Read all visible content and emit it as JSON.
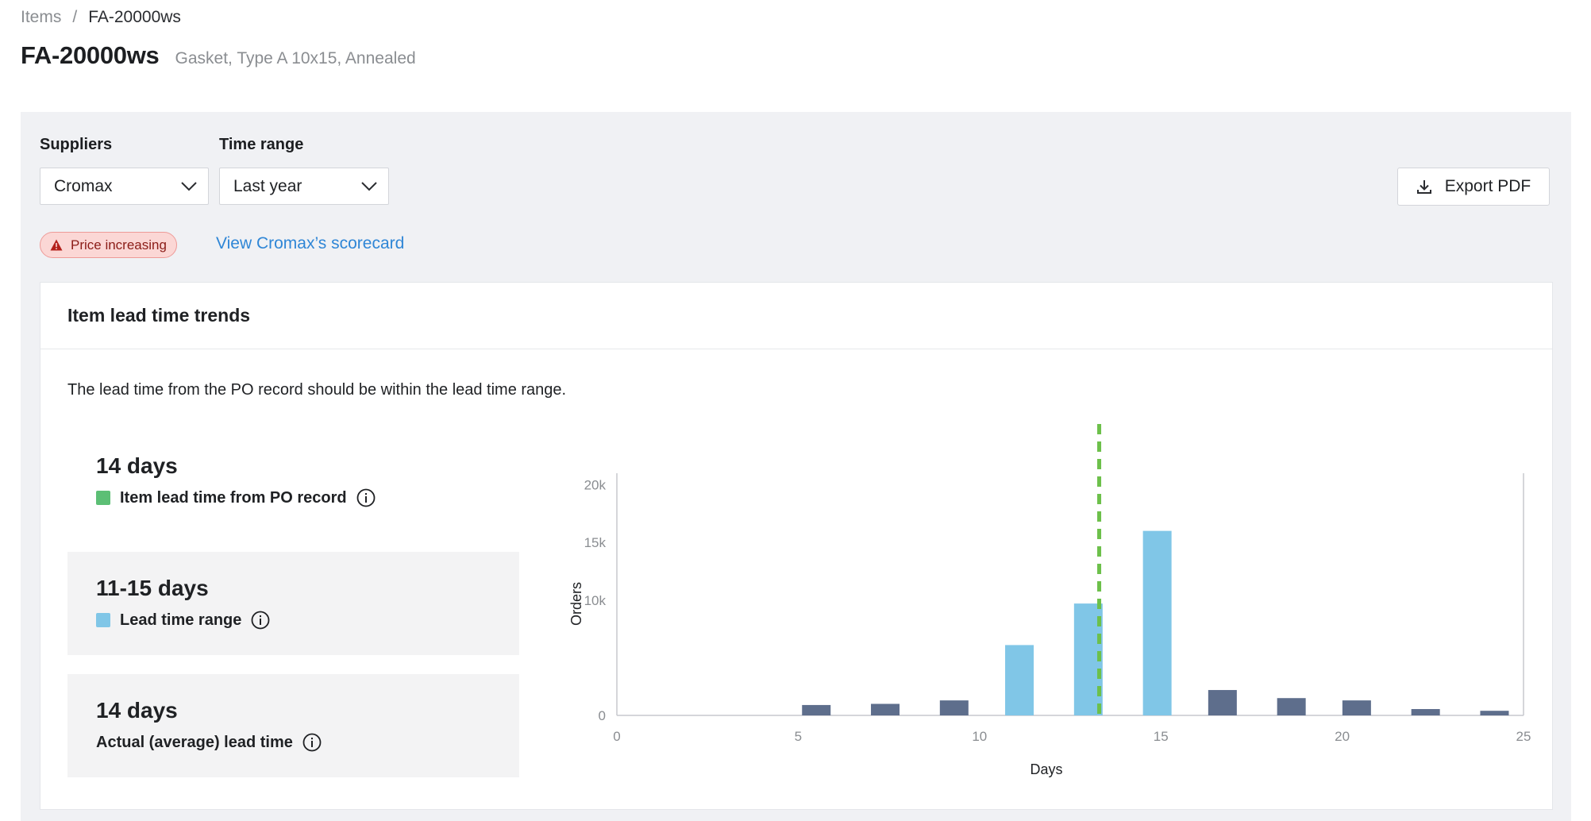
{
  "breadcrumb": {
    "root": "Items",
    "separator": "/",
    "current": "FA-20000ws"
  },
  "header": {
    "title": "FA-20000ws",
    "subtitle": "Gasket, Type A 10x15, Annealed"
  },
  "filters": {
    "suppliers_label": "Suppliers",
    "suppliers_value": "Cromax",
    "time_range_label": "Time range",
    "time_range_value": "Last year",
    "export_label": "Export PDF"
  },
  "alert": {
    "badge_label": "Price increasing",
    "link_label": "View Cromax’s scorecard",
    "badge_color": "#fbd7d5"
  },
  "card": {
    "title": "Item lead time trends",
    "description": "The lead time from the PO record should be within the lead time range."
  },
  "metrics": [
    {
      "value": "14 days",
      "label": "Item lead time from PO record",
      "swatch_color": "#5cbf75",
      "icon": "info-icon"
    },
    {
      "value": "11-15 days",
      "label": "Lead time range",
      "swatch_color": "#80c6e7",
      "icon": "info-icon"
    },
    {
      "value": "14 days",
      "label": "Actual (average) lead time",
      "icon": "info-icon"
    }
  ],
  "chart_data": {
    "type": "bar",
    "xlabel": "Days",
    "ylabel": "Orders",
    "xlim": [
      0,
      25
    ],
    "ylim": [
      0,
      21000
    ],
    "x_ticks": [
      "0",
      "5",
      "10",
      "15",
      "20",
      "25"
    ],
    "y_ticks": [
      "0",
      "10k",
      "15k",
      "20k"
    ],
    "x": [
      5.5,
      7.4,
      9.3,
      11.1,
      13,
      14.9,
      16.7,
      18.6,
      20.4,
      22.3,
      24.2
    ],
    "values": [
      900,
      1000,
      1300,
      6100,
      9700,
      16000,
      2200,
      1500,
      1300,
      550,
      400
    ],
    "in_range": [
      false,
      false,
      false,
      true,
      true,
      true,
      false,
      false,
      false,
      false,
      false
    ],
    "reference_line_x": 13.3,
    "colors": {
      "in_range": "#80c6e7",
      "out_of_range": "#5e6e8c",
      "reference_line": "#6cc04a",
      "axis": "#c7c9cd",
      "tick_text": "#8a8d91"
    }
  }
}
